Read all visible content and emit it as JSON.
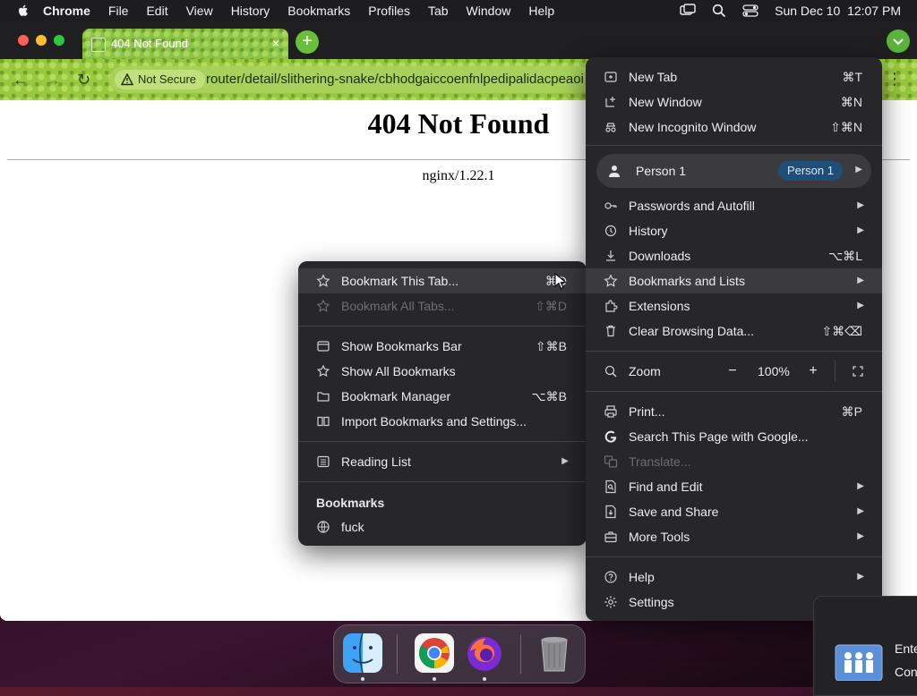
{
  "menubar": {
    "app_name": "Chrome",
    "items": [
      "File",
      "Edit",
      "View",
      "History",
      "Bookmarks",
      "Profiles",
      "Tab",
      "Window",
      "Help"
    ],
    "clock": "Sun Dec 10  12:07 PM"
  },
  "tab": {
    "title": "404 Not Found",
    "close": "×",
    "new_tab": "+"
  },
  "omnibox": {
    "security_label": "Not Secure",
    "url": "router/detail/slithering-snake/cbhodgaiccoenfnlpedipalidacpeaoi"
  },
  "page": {
    "heading": "404 Not Found",
    "server": "nginx/1.22.1"
  },
  "main_menu": {
    "items": [
      {
        "label": "New Tab",
        "shortcut": "⌘T"
      },
      {
        "label": "New Window",
        "shortcut": "⌘N"
      },
      {
        "label": "New Incognito Window",
        "shortcut": "⇧⌘N"
      }
    ],
    "person": {
      "label": "Person 1",
      "badge": "Person 1"
    },
    "group2": [
      {
        "label": "Passwords and Autofill"
      },
      {
        "label": "History"
      },
      {
        "label": "Downloads",
        "shortcut": "⌥⌘L"
      },
      {
        "label": "Bookmarks and Lists"
      },
      {
        "label": "Extensions"
      },
      {
        "label": "Clear Browsing Data...",
        "shortcut": "⇧⌘⌫"
      }
    ],
    "zoom": {
      "label": "Zoom",
      "value": "100%",
      "minus": "−",
      "plus": "+"
    },
    "group3": [
      {
        "label": "Print...",
        "shortcut": "⌘P"
      },
      {
        "label": "Search This Page with Google..."
      },
      {
        "label": "Translate..."
      },
      {
        "label": "Find and Edit"
      },
      {
        "label": "Save and Share"
      },
      {
        "label": "More Tools"
      }
    ],
    "group4": [
      {
        "label": "Help"
      },
      {
        "label": "Settings"
      }
    ]
  },
  "bookmarks_menu": {
    "items": [
      {
        "label": "Bookmark This Tab...",
        "shortcut": "⌘D"
      },
      {
        "label": "Bookmark All Tabs...",
        "shortcut": "⇧⌘D"
      },
      {
        "label": "Show Bookmarks Bar",
        "shortcut": "⇧⌘B"
      },
      {
        "label": "Show All Bookmarks"
      },
      {
        "label": "Bookmark Manager",
        "shortcut": "⌥⌘B"
      },
      {
        "label": "Import Bookmarks and Settings..."
      },
      {
        "label": "Reading List"
      }
    ],
    "section_title": "Bookmarks",
    "bookmark": {
      "label": "fuck"
    }
  },
  "notification": {
    "line1": "Ente",
    "line2": "Con"
  },
  "colors": {
    "theme_green": "#8bc34a",
    "menu_bg": "#272729",
    "badge_blue": "#1f4e7a"
  }
}
